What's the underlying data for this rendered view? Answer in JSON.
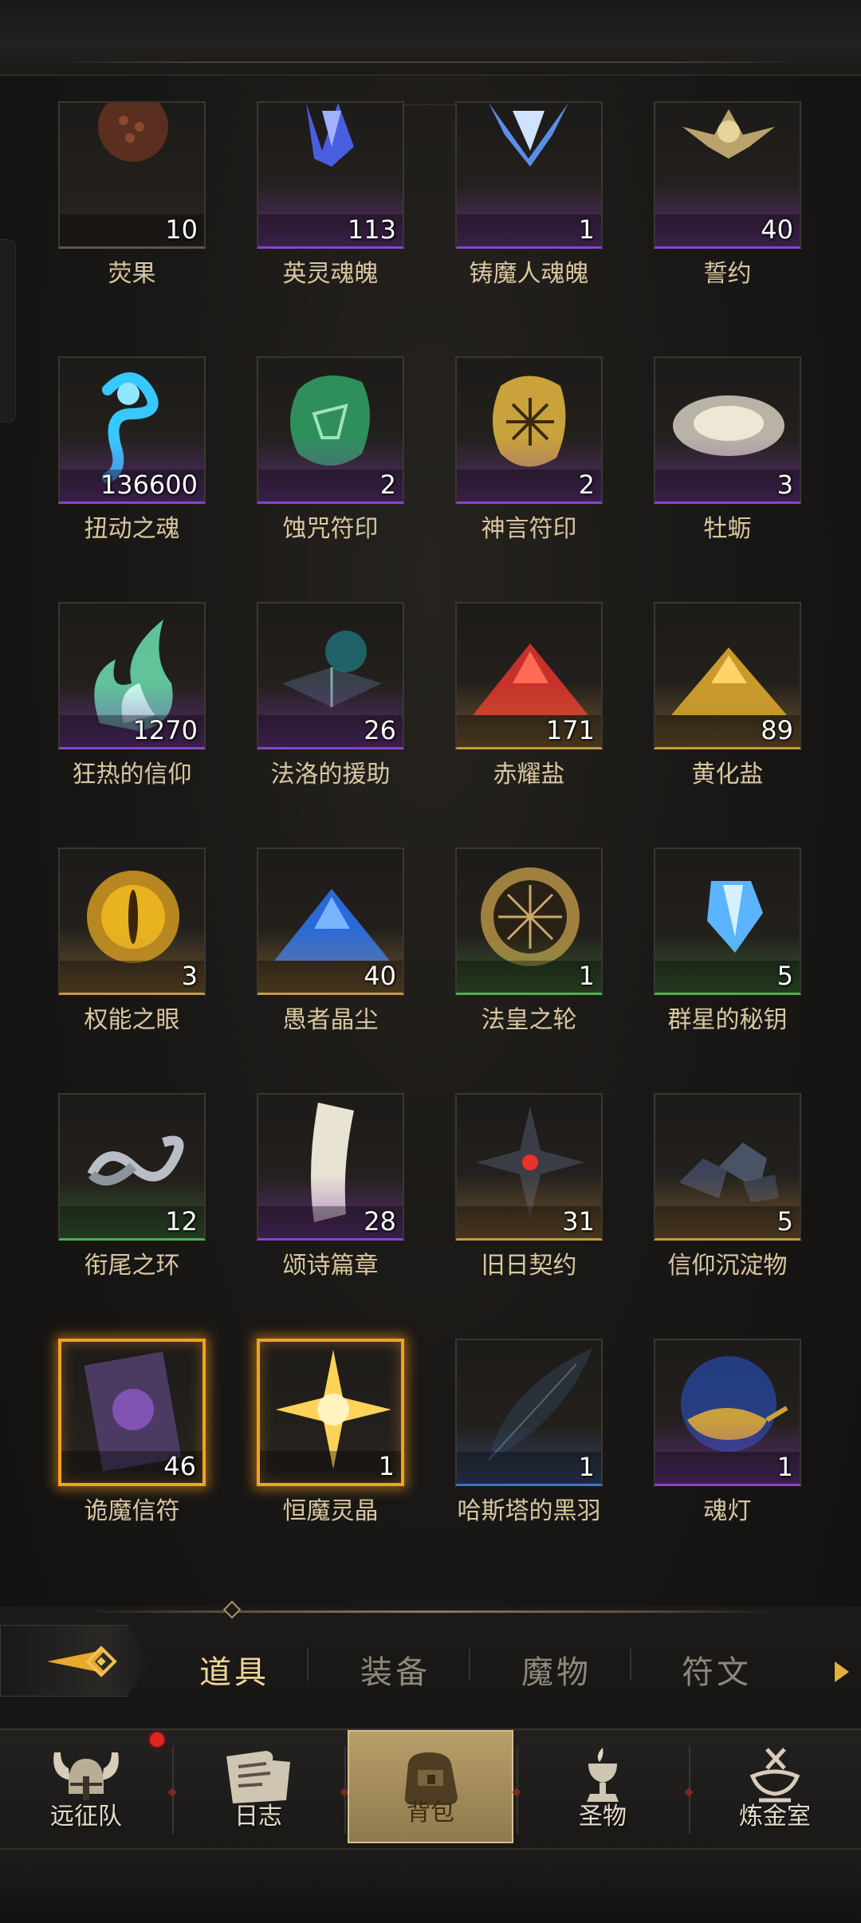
{
  "colors": {
    "accent": "#f1d59a",
    "rarity_purple": "#8a45c6",
    "rarity_gold": "#c69a42",
    "rarity_green": "#4bb34a",
    "rarity_blue": "#3c74c8",
    "legendary": "#f0a321",
    "notification": "#e0241e"
  },
  "inventory": {
    "items": [
      {
        "name": "荧果",
        "count": "10",
        "rarity": "gray",
        "icon": "fruit-icon"
      },
      {
        "name": "英灵魂魄",
        "count": "113",
        "rarity": "purple",
        "icon": "blue-crystal-icon"
      },
      {
        "name": "铸魔人魂魄",
        "count": "1",
        "rarity": "purple",
        "icon": "crystal-shard-icon"
      },
      {
        "name": "誓约",
        "count": "40",
        "rarity": "purple",
        "icon": "star-emblem-icon"
      },
      {
        "name": "扭动之魂",
        "count": "136600",
        "rarity": "purple",
        "icon": "spirit-wisp-icon"
      },
      {
        "name": "蚀咒符印",
        "count": "2",
        "rarity": "purple",
        "icon": "green-rune-stone-icon"
      },
      {
        "name": "神言符印",
        "count": "2",
        "rarity": "purple",
        "icon": "gold-rune-stone-icon"
      },
      {
        "name": "牡蛎",
        "count": "3",
        "rarity": "purple",
        "icon": "oyster-icon"
      },
      {
        "name": "狂热的信仰",
        "count": "1270",
        "rarity": "purple",
        "icon": "green-flame-icon"
      },
      {
        "name": "法洛的援助",
        "count": "26",
        "rarity": "purple",
        "icon": "spellbook-icon"
      },
      {
        "name": "赤耀盐",
        "count": "171",
        "rarity": "gold",
        "icon": "red-salt-icon"
      },
      {
        "name": "黄化盐",
        "count": "89",
        "rarity": "gold",
        "icon": "yellow-salt-icon"
      },
      {
        "name": "权能之眼",
        "count": "3",
        "rarity": "gold",
        "icon": "golden-eye-icon"
      },
      {
        "name": "愚者晶尘",
        "count": "40",
        "rarity": "gold",
        "icon": "blue-dust-icon"
      },
      {
        "name": "法皇之轮",
        "count": "1",
        "rarity": "green",
        "icon": "compass-wheel-icon"
      },
      {
        "name": "群星的秘钥",
        "count": "5",
        "rarity": "green",
        "icon": "blue-gem-icon"
      },
      {
        "name": "衔尾之环",
        "count": "12",
        "rarity": "green",
        "icon": "ouroboros-icon"
      },
      {
        "name": "颂诗篇章",
        "count": "28",
        "rarity": "purple",
        "icon": "scroll-page-icon"
      },
      {
        "name": "旧日契约",
        "count": "31",
        "rarity": "gold",
        "icon": "dark-star-icon"
      },
      {
        "name": "信仰沉淀物",
        "count": "5",
        "rarity": "gold",
        "icon": "ore-chunks-icon"
      },
      {
        "name": "诡魔信符",
        "count": "46",
        "rarity": "legend",
        "icon": "demon-card-icon"
      },
      {
        "name": "恒魔灵晶",
        "count": "1",
        "rarity": "legend",
        "icon": "radiant-star-icon"
      },
      {
        "name": "哈斯塔的黑羽",
        "count": "1",
        "rarity": "blue",
        "icon": "black-feather-icon"
      },
      {
        "name": "魂灯",
        "count": "1",
        "rarity": "purple",
        "icon": "magic-lamp-icon"
      }
    ]
  },
  "category_tabs": {
    "items": [
      {
        "label": "道具",
        "active": true
      },
      {
        "label": "装备",
        "active": false
      },
      {
        "label": "魔物",
        "active": false
      },
      {
        "label": "符文",
        "active": false
      }
    ]
  },
  "bottom_nav": {
    "items": [
      {
        "label": "远征队",
        "icon": "viking-helmet-icon",
        "badge": true
      },
      {
        "label": "日志",
        "icon": "journal-icon",
        "badge": false
      },
      {
        "label": "背包",
        "icon": "backpack-icon",
        "active": true
      },
      {
        "label": "圣物",
        "icon": "chalice-icon",
        "badge": false
      },
      {
        "label": "炼金室",
        "icon": "alchemy-icon",
        "badge": false
      }
    ]
  }
}
